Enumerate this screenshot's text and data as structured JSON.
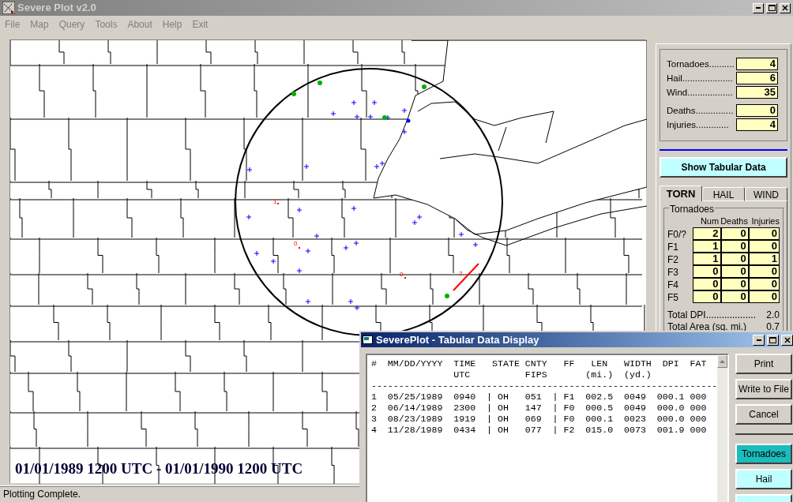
{
  "window": {
    "title": "Severe Plot v2.0"
  },
  "menu": [
    "File",
    "Map",
    "Query",
    "Tools",
    "About",
    "Help",
    "Exit"
  ],
  "map": {
    "labels": [
      "1",
      "0",
      "0",
      "2"
    ],
    "period": "01/01/1989 1200 UTC - 01/01/1990 1200 UTC"
  },
  "summary": {
    "counts": [
      {
        "label": "Tornadoes..........",
        "value": "4"
      },
      {
        "label": "Hail....................",
        "value": "6"
      },
      {
        "label": "Wind..................",
        "value": "35"
      }
    ],
    "casualties": [
      {
        "label": "Deaths...............",
        "value": "0"
      },
      {
        "label": "Injuries.............",
        "value": "4"
      }
    ]
  },
  "show_button": "Show Tabular Data",
  "tabs": [
    {
      "label": "TORN",
      "selected": true
    },
    {
      "label": "HAIL",
      "selected": false
    },
    {
      "label": "WIND",
      "selected": false
    }
  ],
  "tornado_table": {
    "title": "Tornadoes",
    "columns": [
      "Num",
      "Deaths",
      "Injuries"
    ],
    "rows": [
      {
        "label": "F0/?",
        "values": [
          "2",
          "0",
          "0"
        ]
      },
      {
        "label": "F1",
        "values": [
          "1",
          "0",
          "0"
        ]
      },
      {
        "label": "F2",
        "values": [
          "1",
          "0",
          "1"
        ]
      },
      {
        "label": "F3",
        "values": [
          "0",
          "0",
          "0"
        ]
      },
      {
        "label": "F4",
        "values": [
          "0",
          "0",
          "0"
        ]
      },
      {
        "label": "F5",
        "values": [
          "0",
          "0",
          "0"
        ]
      }
    ]
  },
  "totals": [
    {
      "label": "Total DPI...................",
      "value": "2.0"
    },
    {
      "label": "Total Area (sq. mi.)",
      "value": "0.7"
    }
  ],
  "status_bar": "Plotting Complete.",
  "tabular_window": {
    "title": "SeverePlot - Tabular Data Display",
    "header_lines": [
      "#  MM/DD/YYYY  TIME   STATE CNTY   FF   LEN   WIDTH  DPI  FAT",
      "               UTC          FIPS       (mi.)  (yd.)"
    ],
    "separator": "---------------------------------------------------------------",
    "rows": [
      "1  05/25/1989  0940  | OH   051  | F1  002.5  0049  000.1 000",
      "2  06/14/1989  2300  | OH   147  | F0  000.5  0049  000.0 000",
      "3  08/23/1989  1919  | OH   069  | F0  000.1  0023  000.0 000",
      "4  11/28/1989  0434  | OH   077  | F2  015.0  0073  001.9 000"
    ],
    "buttons": [
      {
        "kind": "action",
        "label": "Print"
      },
      {
        "kind": "action",
        "label": "Write to File"
      },
      {
        "kind": "action",
        "label": "Cancel"
      },
      {
        "kind": "toggle",
        "label": "Tornadoes",
        "selected": true
      },
      {
        "kind": "toggle",
        "label": "Hail",
        "selected": false
      },
      {
        "kind": "toggle",
        "selected": false
      }
    ]
  }
}
